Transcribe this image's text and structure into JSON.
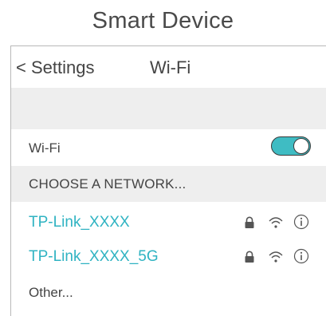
{
  "device_title": "Smart Device",
  "nav": {
    "back_label": "< Settings",
    "title": "Wi-Fi"
  },
  "wifi_row": {
    "label": "Wi-Fi",
    "toggle_on": true
  },
  "section_header": "CHOOSE A NETWORK...",
  "networks": [
    {
      "name": "TP-Link_XXXX",
      "locked": true,
      "icons": [
        "lock-icon",
        "wifi-signal-icon",
        "info-icon"
      ]
    },
    {
      "name": "TP-Link_XXXX_5G",
      "locked": true,
      "icons": [
        "lock-icon",
        "wifi-signal-icon",
        "info-icon"
      ]
    }
  ],
  "other_label": "Other...",
  "colors": {
    "accent": "#2fb3c2",
    "toggle": "#3fbcc3",
    "band": "#eeeeee",
    "text": "#444444"
  }
}
